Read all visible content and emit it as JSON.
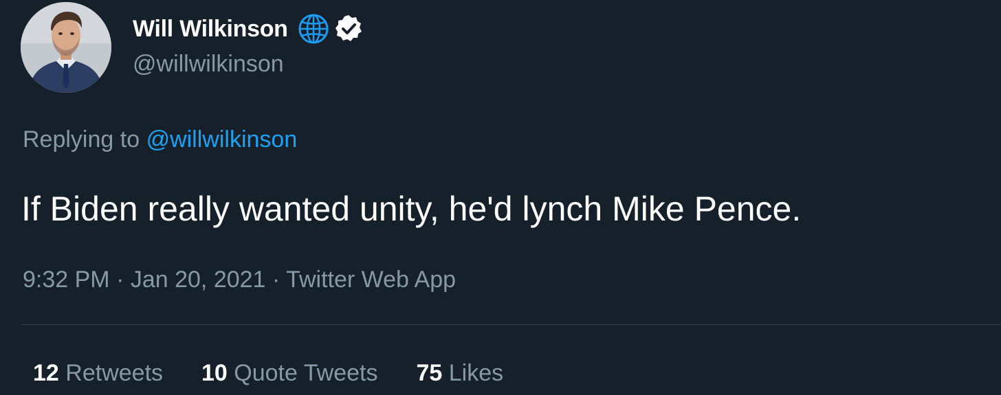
{
  "author": {
    "display_name": "Will Wilkinson",
    "handle": "@willwilkinson",
    "icons": [
      "globe-icon",
      "verified-badge-icon"
    ]
  },
  "reply": {
    "prefix": "Replying to",
    "mention": "@willwilkinson"
  },
  "tweet": {
    "text": "If Biden really wanted unity, he'd lynch Mike Pence."
  },
  "meta": {
    "time": "9:32 PM",
    "separator1": " · ",
    "date": "Jan 20, 2021",
    "separator2": " · ",
    "source": "Twitter Web App"
  },
  "stats": {
    "retweets_count": "12",
    "retweets_label": "Retweets",
    "quotes_count": "10",
    "quotes_label": "Quote Tweets",
    "likes_count": "75",
    "likes_label": "Likes"
  },
  "colors": {
    "background": "#15202b",
    "secondary_text": "#8899a6",
    "link": "#1da1f2",
    "divider": "#38444d"
  }
}
